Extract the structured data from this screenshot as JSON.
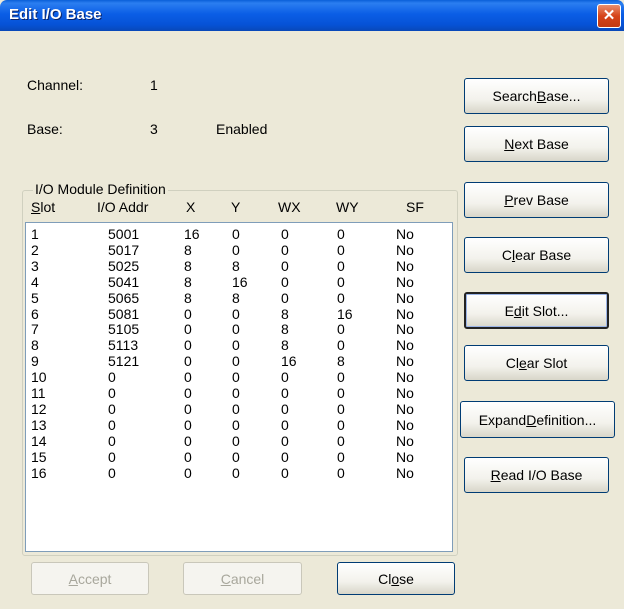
{
  "window": {
    "title": "Edit I/O Base",
    "close_glyph": "✕"
  },
  "info": {
    "channel_label": "Channel:",
    "channel_value": "1",
    "base_label": "Base:",
    "base_value": "3",
    "base_status": "Enabled"
  },
  "group": {
    "label": "I/O Module Definition",
    "columns": {
      "slot_u": "S",
      "slot_rest": "lot",
      "addr": "I/O Addr",
      "x": "X",
      "y": "Y",
      "wx": "WX",
      "wy": "WY",
      "sf": "SF"
    }
  },
  "rows": [
    {
      "slot": "1",
      "addr": "5001",
      "x": "16",
      "y": "0",
      "wx": "0",
      "wy": "0",
      "sf": "No"
    },
    {
      "slot": "2",
      "addr": "5017",
      "x": "8",
      "y": "0",
      "wx": "0",
      "wy": "0",
      "sf": "No"
    },
    {
      "slot": "3",
      "addr": "5025",
      "x": "8",
      "y": "8",
      "wx": "0",
      "wy": "0",
      "sf": "No"
    },
    {
      "slot": "4",
      "addr": "5041",
      "x": "8",
      "y": "16",
      "wx": "0",
      "wy": "0",
      "sf": "No"
    },
    {
      "slot": "5",
      "addr": "5065",
      "x": "8",
      "y": "8",
      "wx": "0",
      "wy": "0",
      "sf": "No"
    },
    {
      "slot": "6",
      "addr": "5081",
      "x": "0",
      "y": "0",
      "wx": "8",
      "wy": "16",
      "sf": "No"
    },
    {
      "slot": "7",
      "addr": "5105",
      "x": "0",
      "y": "0",
      "wx": "8",
      "wy": "0",
      "sf": "No"
    },
    {
      "slot": "8",
      "addr": "5113",
      "x": "0",
      "y": "0",
      "wx": "8",
      "wy": "0",
      "sf": "No"
    },
    {
      "slot": "9",
      "addr": "5121",
      "x": "0",
      "y": "0",
      "wx": "16",
      "wy": "8",
      "sf": "No"
    },
    {
      "slot": "10",
      "addr": "0",
      "x": "0",
      "y": "0",
      "wx": "0",
      "wy": "0",
      "sf": "No"
    },
    {
      "slot": "11",
      "addr": "0",
      "x": "0",
      "y": "0",
      "wx": "0",
      "wy": "0",
      "sf": "No"
    },
    {
      "slot": "12",
      "addr": "0",
      "x": "0",
      "y": "0",
      "wx": "0",
      "wy": "0",
      "sf": "No"
    },
    {
      "slot": "13",
      "addr": "0",
      "x": "0",
      "y": "0",
      "wx": "0",
      "wy": "0",
      "sf": "No"
    },
    {
      "slot": "14",
      "addr": "0",
      "x": "0",
      "y": "0",
      "wx": "0",
      "wy": "0",
      "sf": "No"
    },
    {
      "slot": "15",
      "addr": "0",
      "x": "0",
      "y": "0",
      "wx": "0",
      "wy": "0",
      "sf": "No"
    },
    {
      "slot": "16",
      "addr": "0",
      "x": "0",
      "y": "0",
      "wx": "0",
      "wy": "0",
      "sf": "No"
    }
  ],
  "side_buttons": {
    "search_base": {
      "pre": "Search ",
      "u": "B",
      "post": "ase..."
    },
    "next_base": {
      "pre": "",
      "u": "N",
      "post": "ext Base"
    },
    "prev_base": {
      "pre": "",
      "u": "P",
      "post": "rev Base"
    },
    "clear_base": {
      "pre": "C",
      "u": "l",
      "post": "ear Base"
    },
    "edit_slot": {
      "pre": "E",
      "u": "d",
      "post": "it Slot..."
    },
    "clear_slot": {
      "pre": "Cl",
      "u": "e",
      "post": "ar Slot"
    },
    "expand_definition": {
      "pre": "Expand ",
      "u": "D",
      "post": "efinition..."
    },
    "read_io_base": {
      "pre": "",
      "u": "R",
      "post": "ead I/O Base"
    }
  },
  "bottom_buttons": {
    "accept": {
      "pre": "",
      "u": "A",
      "post": "ccept"
    },
    "cancel": {
      "pre": "",
      "u": "C",
      "post": "ancel"
    },
    "close": {
      "pre": "Cl",
      "u": "o",
      "post": "se"
    }
  }
}
